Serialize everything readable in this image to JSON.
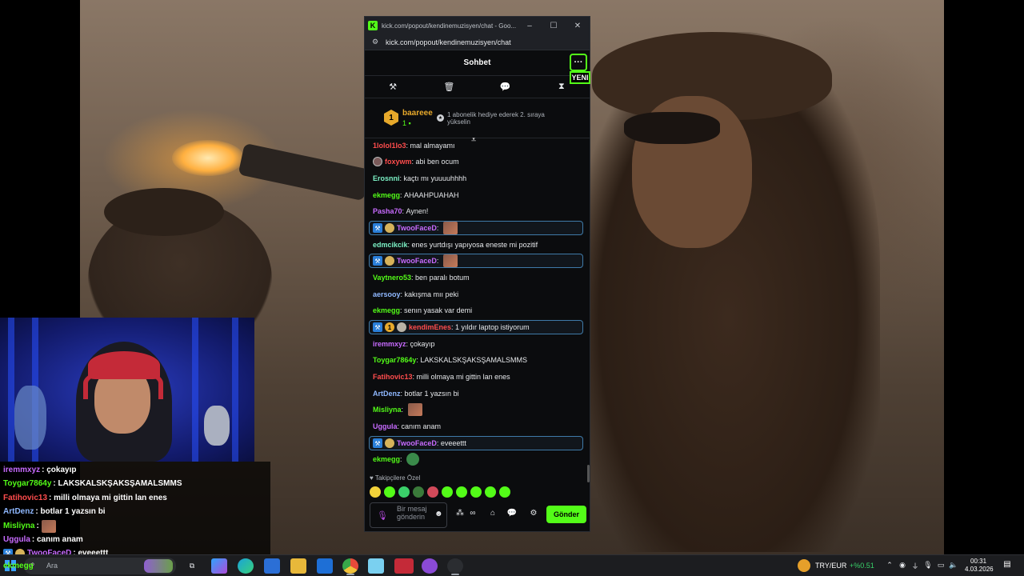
{
  "browser": {
    "window_title": "kick.com/popout/kendinemuzisyen/chat - Goo...",
    "url": "kick.com/popout/kendinemuzisyen/chat",
    "minimize": "–",
    "maximize": "☐",
    "close": "✕"
  },
  "chat": {
    "title": "Sohbet",
    "menu_icon": "···",
    "new_badge": "YENI",
    "pinned": {
      "rank": "1",
      "username": "baareee",
      "count": "1",
      "gift_text": "1 abonelik hediye ederek 2. sıraya yükselin"
    },
    "messages": [
      {
        "user": "1lolol1lo3",
        "text": "mal almayamı",
        "color": "#ff4d4d"
      },
      {
        "user": "foxywm",
        "text": "abi ben ocum",
        "color": "#ff4d4d"
      },
      {
        "user": "Erosnni",
        "text": "kaçtı mı yuuuuhhhh",
        "color": "#7cf2c6"
      },
      {
        "user": "ekmegg",
        "text": "AHAAHPUAHAH",
        "color": "#53fc18"
      },
      {
        "user": "Pasha70",
        "text": "Aynen!",
        "color": "#c86bff"
      },
      {
        "user": "TwooFaceD",
        "text": "",
        "color": "#c86bff"
      },
      {
        "user": "edmcikcik",
        "text": "enes yurtdışı yapıyosa eneste mi pozitif",
        "color": "#7cf2c6"
      },
      {
        "user": "TwooFaceD",
        "text": "",
        "color": "#c86bff"
      },
      {
        "user": "Vaytnero53",
        "text": "ben paralı botum",
        "color": "#53fc18"
      },
      {
        "user": "aersooy",
        "text": "kakışma mıı peki",
        "color": "#8fb8ff"
      },
      {
        "user": "ekmegg",
        "text": "senın yasak var demi",
        "color": "#53fc18"
      },
      {
        "user": "kendimEnes",
        "text": "1 yıldır laptop istiyorum",
        "color": "#ff4d4d"
      },
      {
        "user": "iremmxyz",
        "text": "çokayıp",
        "color": "#c86bff"
      },
      {
        "user": "Toygar7864y",
        "text": "LAKSKALSKŞAKSŞAMALSMMS",
        "color": "#53fc18"
      },
      {
        "user": "Fatihovic13",
        "text": "milli olmaya mi gittin lan enes",
        "color": "#ff4d4d"
      },
      {
        "user": "ArtDenz",
        "text": "botlar 1 yazsın bi",
        "color": "#8fb8ff"
      },
      {
        "user": "Misliyna",
        "text": "",
        "color": "#53fc18"
      },
      {
        "user": "Uggula",
        "text": "canım anam",
        "color": "#c86bff"
      },
      {
        "user": "TwooFaceD",
        "text": "eveeettt",
        "color": "#c86bff"
      },
      {
        "user": "ekmegg",
        "text": "",
        "color": "#53fc18"
      }
    ],
    "emote_section_label": "♥ Takipçilere Özel",
    "input_placeholder": "Bir mesaj gönderin",
    "send_label": "Gönder"
  },
  "overlay_chat": [
    {
      "user": "iremmxyz",
      "text": ": çokayıp",
      "color": "#c86bff"
    },
    {
      "user": "Toygar7864y",
      "text": ": LAKSKALSKŞAKSŞAMALSMMS",
      "color": "#53fc18"
    },
    {
      "user": "Fatihovic13",
      "text": ": milli olmaya mi gittin lan enes",
      "color": "#ff4d4d"
    },
    {
      "user": "ArtDenz",
      "text": ": botlar 1 yazsın bi",
      "color": "#8fb8ff"
    },
    {
      "user": "Misliyna",
      "text": ":",
      "color": "#53fc18"
    },
    {
      "user": "Uggula",
      "text": ": canım anam",
      "color": "#c86bff"
    },
    {
      "user": "TwooFaceD",
      "text": ": eveeettt",
      "color": "#c86bff"
    },
    {
      "user": "ekmegg",
      "text": "",
      "color": "#53fc18"
    }
  ],
  "taskbar": {
    "search_placeholder": "Ara",
    "fx_label": "TRY/EUR",
    "fx_change": "+%0.51",
    "time": "00:31",
    "date": "4.03.2026"
  },
  "colors": {
    "kick_green": "#53fc18",
    "mod_blue": "#2a7fd9"
  }
}
